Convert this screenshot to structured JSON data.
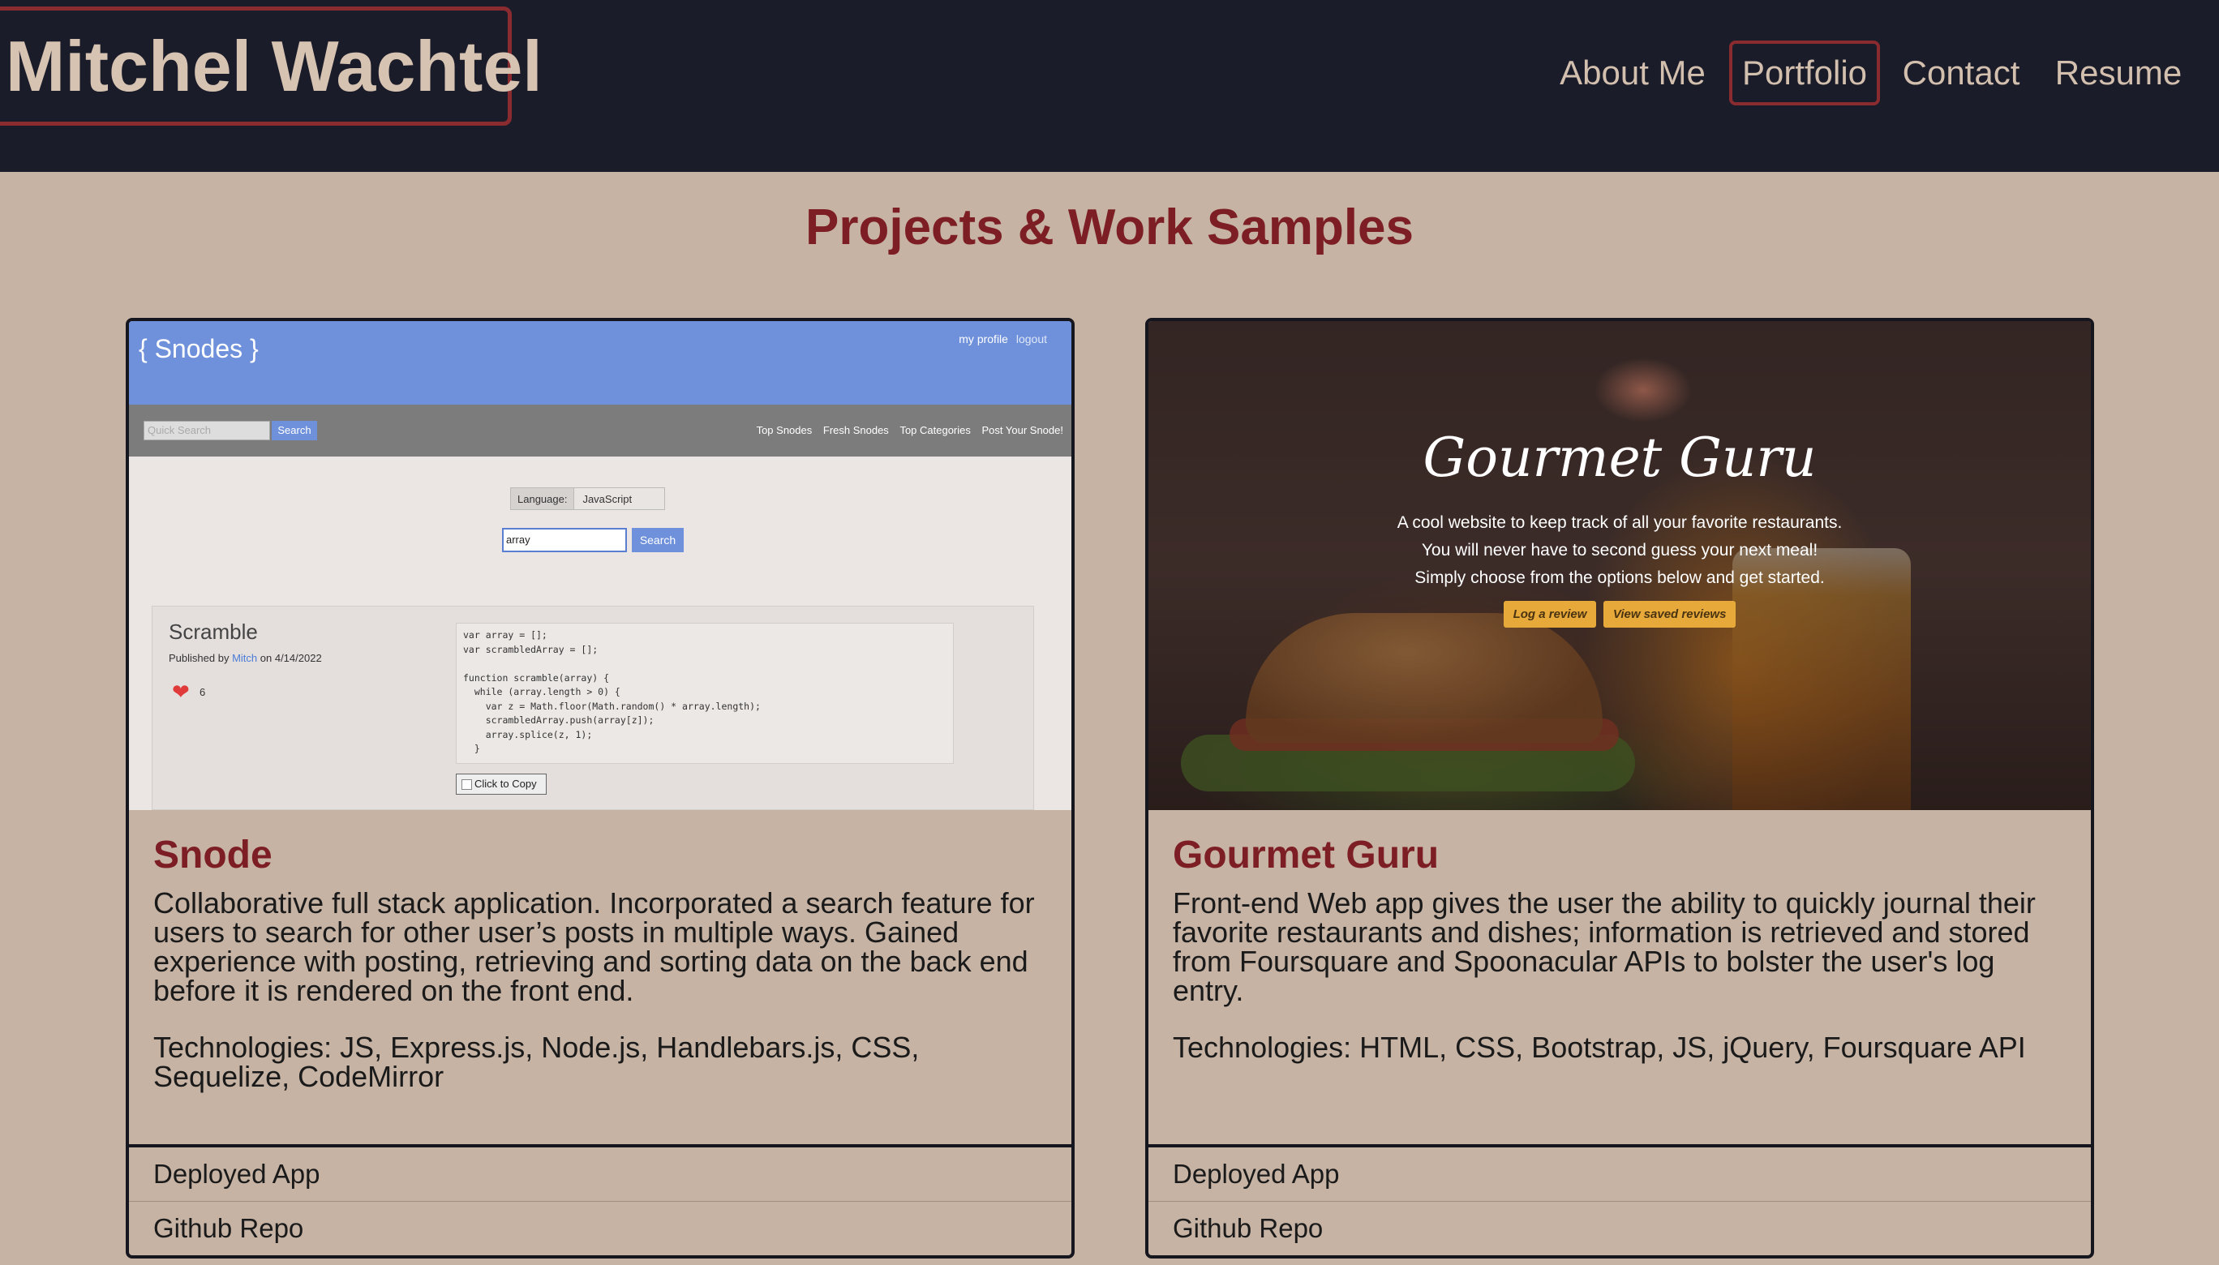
{
  "header": {
    "brand": "Mitchel Wachtel",
    "nav": [
      "About Me",
      "Portfolio",
      "Contact",
      "Resume"
    ],
    "active": "Portfolio"
  },
  "page_title": "Projects & Work Samples",
  "projects": [
    {
      "title": "Snode",
      "description": "Collaborative full stack application. Incorporated a search feature for users to search for other user’s posts in multiple ways. Gained experience with posting, retrieving and sorting data on the back end before it is rendered on the front end.",
      "technologies": "Technologies: JS, Express.js, Node.js, Handlebars.js, CSS, Sequelize, CodeMirror",
      "links": [
        "Deployed App",
        "Github Repo"
      ],
      "screenshot": {
        "logo": "{ Snodes }",
        "top_links": [
          "my profile",
          "logout"
        ],
        "quick_search_placeholder": "Quick Search",
        "quick_search_button": "Search",
        "menu": [
          "Top Snodes",
          "Fresh Snodes",
          "Top Categories",
          "Post Your Snode!"
        ],
        "language_label": "Language:",
        "language_value": "JavaScript",
        "search_value": "array",
        "search_button": "Search",
        "post_title": "Scramble",
        "post_by_prefix": "Published by",
        "post_author": "Mitch",
        "post_date": "on 4/14/2022",
        "likes": "6",
        "code": "var array = [];\nvar scrambledArray = [];\n\nfunction scramble(array) {\n  while (array.length > 0) {\n    var z = Math.floor(Math.random() * array.length);\n    scrambledArray.push(array[z]);\n    array.splice(z, 1);\n  }",
        "copy_button": "Click to Copy"
      }
    },
    {
      "title": "Gourmet Guru",
      "description": "Front-end Web app gives the user the ability to quickly journal their favorite restaurants and dishes; information is retrieved and stored from Foursquare and Spoonacular APIs to bolster the user's log entry.",
      "technologies": "Technologies: HTML, CSS, Bootstrap, JS, jQuery, Foursquare API",
      "links": [
        "Deployed App",
        "Github Repo"
      ],
      "screenshot": {
        "title": "Gourmet Guru",
        "lines": [
          "A cool website to keep track of all your favorite restaurants.",
          "You will never have to second guess your next meal!",
          "Simply choose from the options below and get started."
        ],
        "buttons": [
          "Log a review",
          "View saved reviews"
        ]
      }
    }
  ],
  "colors": {
    "header_bg": "#1b1c2a",
    "accent": "#7c1e24",
    "page_bg": "#c6b3a4",
    "border": "#8a2b2f"
  }
}
